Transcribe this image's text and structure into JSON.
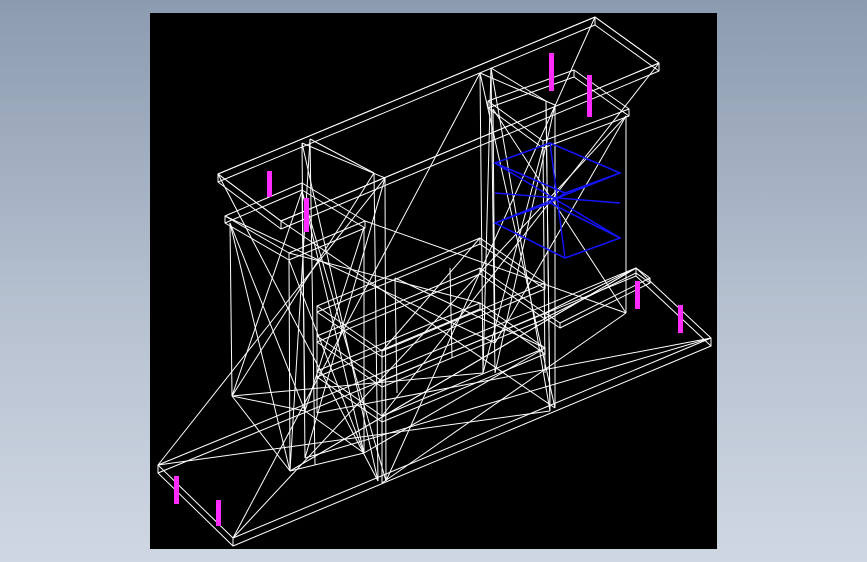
{
  "viewport": {
    "background": "#000000",
    "wire_color": "#ffffff",
    "brace_color": "#1515ff",
    "pin_color": "#ff2bff"
  },
  "model": {
    "name": "wireframe-frame-structure",
    "components": [
      "left-tower",
      "right-tower",
      "bridge-beam",
      "base-platform",
      "shelf-assembly",
      "blue-cross-bracing",
      "magenta-pins"
    ]
  }
}
